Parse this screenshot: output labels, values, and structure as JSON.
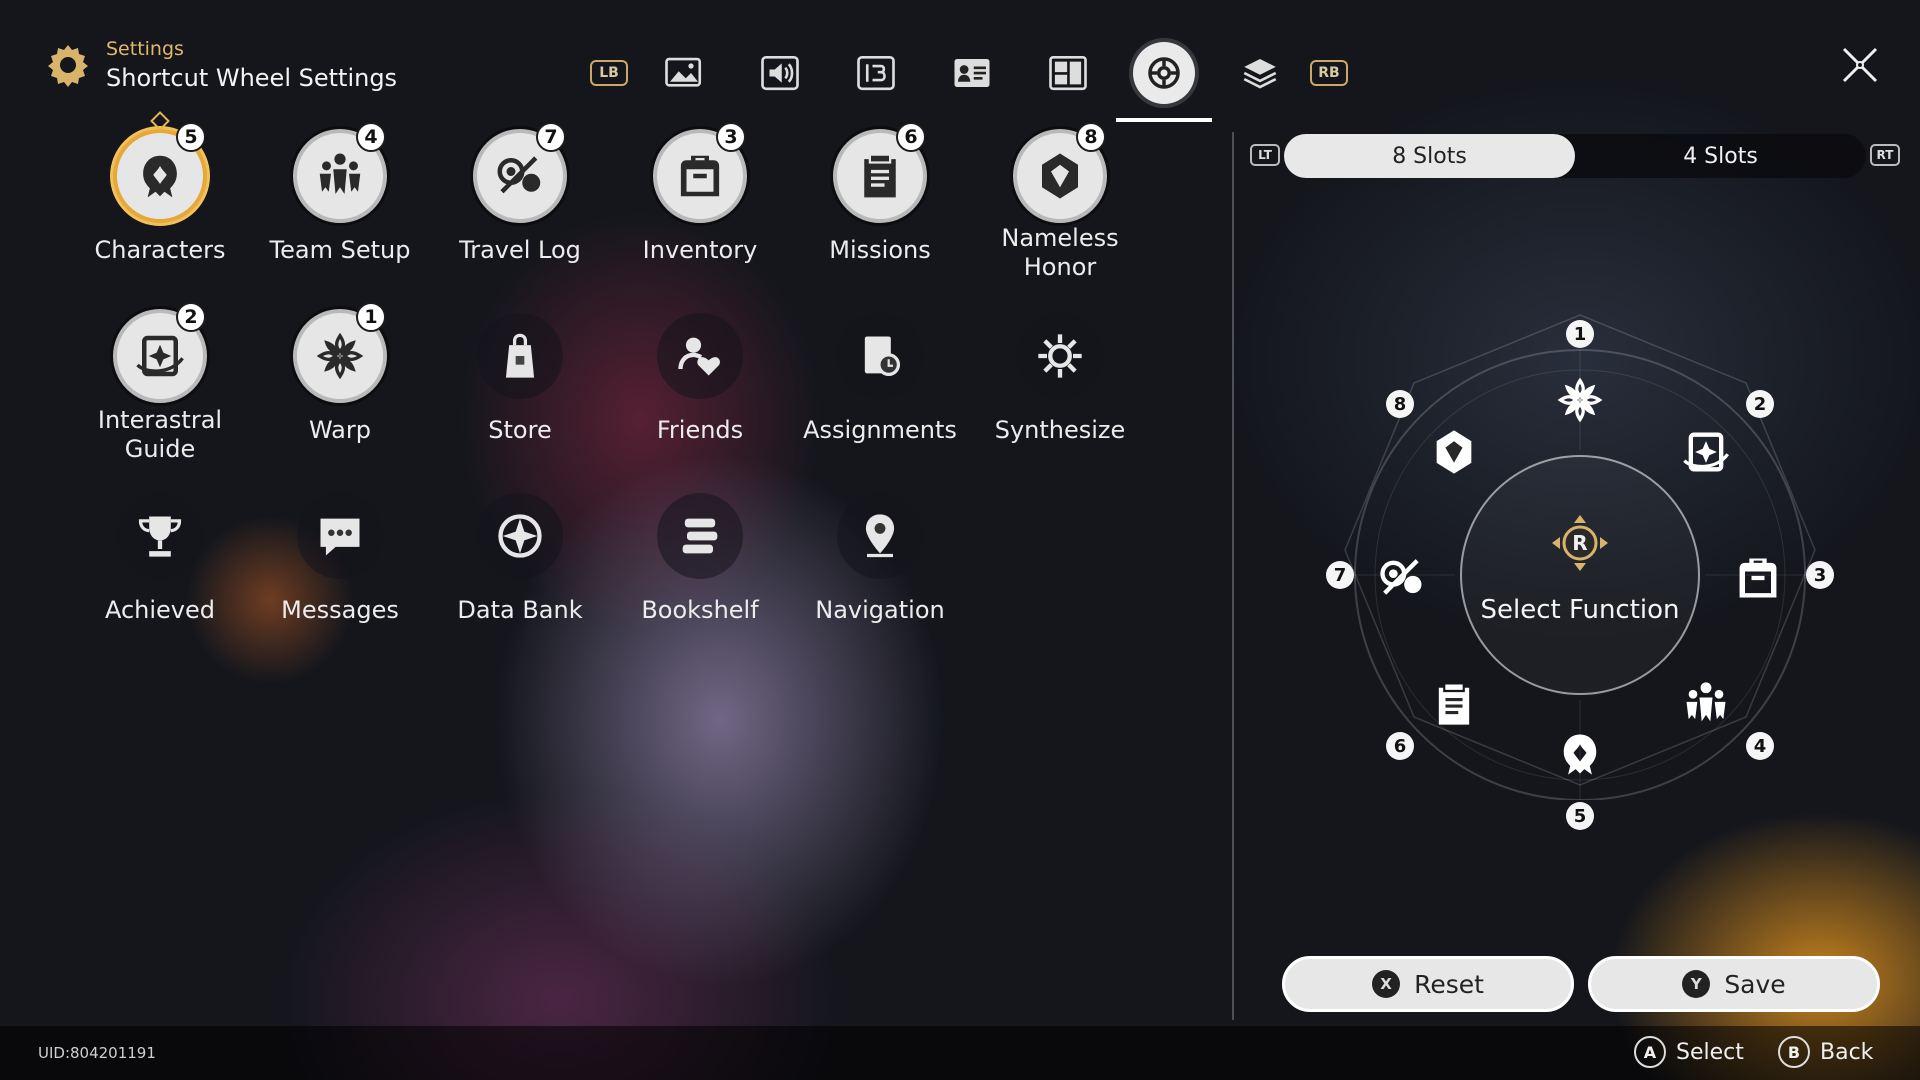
{
  "header": {
    "breadcrumb": "Settings",
    "title": "Shortcut Wheel Settings"
  },
  "tabs": {
    "lb_hint": "LB",
    "rb_hint": "RB",
    "items": [
      {
        "icon": "image-icon"
      },
      {
        "icon": "audio-icon"
      },
      {
        "icon": "language-icon"
      },
      {
        "icon": "profile-card-icon"
      },
      {
        "icon": "layout-icon"
      },
      {
        "icon": "wheel-icon",
        "active": true
      },
      {
        "icon": "layers-icon"
      }
    ]
  },
  "functions": [
    {
      "label": "Characters",
      "badge": "5",
      "slotted": true,
      "selected": true,
      "icon": "character-icon"
    },
    {
      "label": "Team Setup",
      "badge": "4",
      "slotted": true,
      "icon": "team-icon"
    },
    {
      "label": "Travel Log",
      "badge": "7",
      "slotted": true,
      "icon": "travel-log-icon"
    },
    {
      "label": "Inventory",
      "badge": "3",
      "slotted": true,
      "icon": "backpack-icon"
    },
    {
      "label": "Missions",
      "badge": "6",
      "slotted": true,
      "icon": "clipboard-icon"
    },
    {
      "label": "Nameless Honor",
      "badge": "8",
      "slotted": true,
      "icon": "honor-icon"
    },
    {
      "label": "Interastral Guide",
      "badge": "2",
      "slotted": true,
      "icon": "guide-icon"
    },
    {
      "label": "Warp",
      "badge": "1",
      "slotted": true,
      "icon": "warp-icon"
    },
    {
      "label": "Store",
      "badge": "",
      "slotted": false,
      "icon": "shopping-bag-icon"
    },
    {
      "label": "Friends",
      "badge": "",
      "slotted": false,
      "icon": "friends-icon"
    },
    {
      "label": "Assignments",
      "badge": "",
      "slotted": false,
      "icon": "assignments-icon"
    },
    {
      "label": "Synthesize",
      "badge": "",
      "slotted": false,
      "icon": "synthesize-icon"
    },
    {
      "label": "Achieved",
      "badge": "",
      "slotted": false,
      "icon": "trophy-icon"
    },
    {
      "label": "Messages",
      "badge": "",
      "slotted": false,
      "icon": "chat-icon"
    },
    {
      "label": "Data Bank",
      "badge": "",
      "slotted": false,
      "icon": "data-bank-icon"
    },
    {
      "label": "Bookshelf",
      "badge": "",
      "slotted": false,
      "icon": "books-icon"
    },
    {
      "label": "Navigation",
      "badge": "",
      "slotted": false,
      "icon": "map-pin-icon"
    }
  ],
  "slots_toggle": {
    "lt": "LT",
    "rt": "RT",
    "options": [
      "8 Slots",
      "4 Slots"
    ],
    "selected": "8 Slots"
  },
  "wheel": {
    "center_button": "R",
    "center_text": "Select Function",
    "slots": [
      {
        "num": "1",
        "icon": "warp-icon"
      },
      {
        "num": "2",
        "icon": "guide-icon"
      },
      {
        "num": "3",
        "icon": "backpack-icon"
      },
      {
        "num": "4",
        "icon": "team-icon"
      },
      {
        "num": "5",
        "icon": "character-icon"
      },
      {
        "num": "6",
        "icon": "clipboard-icon"
      },
      {
        "num": "7",
        "icon": "travel-log-icon"
      },
      {
        "num": "8",
        "icon": "honor-icon"
      }
    ]
  },
  "actions": {
    "reset": {
      "key": "X",
      "label": "Reset"
    },
    "save": {
      "key": "Y",
      "label": "Save"
    }
  },
  "footer": {
    "uid": "UID:804201191",
    "hints": [
      {
        "key": "A",
        "label": "Select"
      },
      {
        "key": "B",
        "label": "Back"
      }
    ]
  },
  "colors": {
    "accent_gold": "#e7a83a",
    "panel_light": "#e7e7e7",
    "background": "#14161c"
  }
}
